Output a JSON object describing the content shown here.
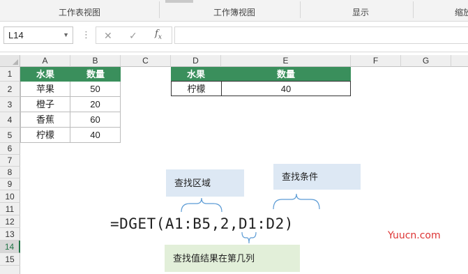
{
  "ribbon": {
    "groups": [
      "工作表视图",
      "工作簿视图",
      "显示",
      "缩放"
    ]
  },
  "formula_bar": {
    "name_box": "L14",
    "fx_label": "fx",
    "cancel_icon": "close-icon",
    "enter_icon": "checkmark-icon",
    "formula": ""
  },
  "columns": [
    "A",
    "B",
    "C",
    "D",
    "E",
    "F",
    "G"
  ],
  "rows": [
    "1",
    "2",
    "3",
    "4",
    "5",
    "6",
    "7",
    "8",
    "9",
    "10",
    "11",
    "12",
    "13",
    "14",
    "15"
  ],
  "selected_row": "14",
  "source_table": {
    "headers": [
      "水果",
      "数量"
    ],
    "rows": [
      [
        "苹果",
        "50"
      ],
      [
        "橙子",
        "20"
      ],
      [
        "香蕉",
        "60"
      ],
      [
        "柠檬",
        "40"
      ]
    ]
  },
  "criteria_table": {
    "headers": [
      "水果",
      "数量"
    ],
    "row": [
      "柠檬",
      "40"
    ]
  },
  "annotations": {
    "range_label": "查找区域",
    "criteria_label": "查找条件",
    "column_label": "查找值结果在第几列",
    "formula_text": "=DGET(A1:B5,2,D1:D2)"
  },
  "watermark": "Yuucn.com",
  "colors": {
    "header_green": "#3a8f5c",
    "callout_blue": "#dde8f4",
    "callout_green": "#e2efd9",
    "bracket_blue": "#5b9bd5"
  }
}
